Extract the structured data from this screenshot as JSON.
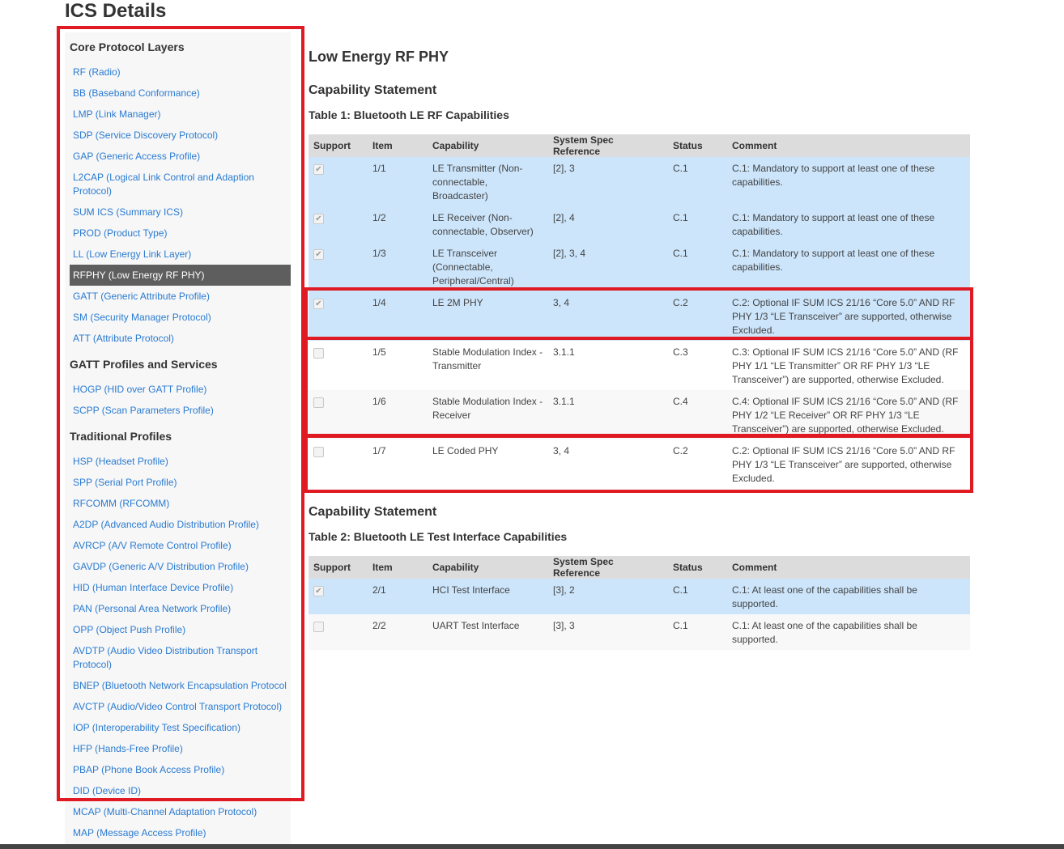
{
  "page": {
    "title": "ICS Details"
  },
  "sidebar": {
    "sections": [
      {
        "heading": "Core Protocol Layers",
        "items": [
          {
            "label": "RF (Radio)"
          },
          {
            "label": "BB (Baseband Conformance)"
          },
          {
            "label": "LMP (Link Manager)"
          },
          {
            "label": "SDP (Service Discovery Protocol)"
          },
          {
            "label": "GAP (Generic Access Profile)"
          },
          {
            "label": "L2CAP (Logical Link Control and Adaption Protocol)"
          },
          {
            "label": "SUM ICS (Summary ICS)"
          },
          {
            "label": "PROD (Product Type)"
          },
          {
            "label": "LL (Low Energy Link Layer)"
          },
          {
            "label": "RFPHY (Low Energy RF PHY)"
          },
          {
            "label": "GATT (Generic Attribute Profile)"
          },
          {
            "label": "SM (Security Manager Protocol)"
          },
          {
            "label": "ATT (Attribute Protocol)"
          }
        ]
      },
      {
        "heading": "GATT Profiles and Services",
        "items": [
          {
            "label": "HOGP (HID over GATT Profile)"
          },
          {
            "label": "SCPP (Scan Parameters Profile)"
          }
        ]
      },
      {
        "heading": "Traditional Profiles",
        "items": [
          {
            "label": "HSP (Headset Profile)"
          },
          {
            "label": "SPP (Serial Port Profile)"
          },
          {
            "label": "RFCOMM (RFCOMM)"
          },
          {
            "label": "A2DP (Advanced Audio Distribution Profile)"
          },
          {
            "label": "AVRCP (A/V Remote Control Profile)"
          },
          {
            "label": "GAVDP (Generic A/V Distribution Profile)"
          },
          {
            "label": "HID (Human Interface Device Profile)"
          },
          {
            "label": "PAN (Personal Area Network Profile)"
          },
          {
            "label": "OPP (Object Push Profile)"
          },
          {
            "label": "AVDTP (Audio Video Distribution Transport Protocol)"
          },
          {
            "label": "BNEP (Bluetooth Network Encapsulation Protocol"
          },
          {
            "label": "AVCTP (Audio/Video Control Transport Protocol)"
          },
          {
            "label": "IOP (Interoperability Test Specification)"
          },
          {
            "label": "HFP (Hands-Free Profile)"
          },
          {
            "label": "PBAP (Phone Book Access Profile)"
          },
          {
            "label": "DID (Device ID)"
          },
          {
            "label": "MCAP (Multi-Channel Adaptation Protocol)"
          },
          {
            "label": "MAP (Message Access Profile)"
          }
        ]
      }
    ],
    "active_item": "RFPHY (Low Energy RF PHY)"
  },
  "main": {
    "section_title": "Low Energy RF PHY",
    "headers": [
      "Support",
      "Item",
      "Capability",
      "System Spec Reference",
      "Status",
      "Comment"
    ],
    "tables": [
      {
        "capability_title": "Capability Statement",
        "table_title": "Table 1: Bluetooth LE RF Capabilities",
        "rows": [
          {
            "checked": true,
            "item": "1/1",
            "capability": "LE Transmitter (Non-connectable, Broadcaster)",
            "ref": "[2], 3",
            "status": "C.1",
            "comment": "C.1: Mandatory to support at least one of these capabilities."
          },
          {
            "checked": true,
            "item": "1/2",
            "capability": "LE Receiver (Non-connectable, Observer)",
            "ref": "[2], 4",
            "status": "C.1",
            "comment": "C.1: Mandatory to support at least one of these capabilities."
          },
          {
            "checked": true,
            "item": "1/3",
            "capability": "LE Transceiver (Connectable, Peripheral/Central)",
            "ref": "[2], 3, 4",
            "status": "C.1",
            "comment": "C.1: Mandatory to support at least one of these capabilities."
          },
          {
            "checked": true,
            "item": "1/4",
            "capability": "LE 2M PHY",
            "ref": "3, 4",
            "status": "C.2",
            "comment": "C.2: Optional IF SUM ICS 21/16 “Core 5.0” AND RF PHY 1/3 “LE Transceiver” are supported, otherwise Excluded."
          },
          {
            "checked": false,
            "item": "1/5",
            "capability": "Stable Modulation Index - Transmitter",
            "ref": "3.1.1",
            "status": "C.3",
            "comment": "C.3: Optional IF SUM ICS 21/16 “Core 5.0” AND (RF PHY 1/1 “LE Transmitter” OR RF PHY 1/3 “LE Transceiver”) are supported, otherwise Excluded."
          },
          {
            "checked": false,
            "item": "1/6",
            "capability": "Stable Modulation Index - Receiver",
            "ref": "3.1.1",
            "status": "C.4",
            "comment": "C.4: Optional IF SUM ICS 21/16 “Core 5.0” AND (RF PHY 1/2 “LE Receiver” OR RF PHY 1/3 “LE Transceiver”) are supported, otherwise Excluded."
          },
          {
            "checked": false,
            "item": "1/7",
            "capability": "LE Coded PHY",
            "ref": "3, 4",
            "status": "C.2",
            "comment": "C.2: Optional IF SUM ICS 21/16 “Core 5.0” AND RF PHY 1/3 “LE Transceiver” are supported, otherwise Excluded."
          }
        ]
      },
      {
        "capability_title": "Capability Statement",
        "table_title": "Table 2: Bluetooth LE Test Interface Capabilities",
        "rows": [
          {
            "checked": true,
            "item": "2/1",
            "capability": "HCI Test Interface",
            "ref": "[3], 2",
            "status": "C.1",
            "comment": "C.1: At least one of the capabilities shall be supported."
          },
          {
            "checked": false,
            "item": "2/2",
            "capability": "UART Test Interface",
            "ref": "[3], 3",
            "status": "C.1",
            "comment": "C.1: At least one of the capabilities shall be supported."
          }
        ]
      }
    ]
  },
  "colors": {
    "link": "#2a7bd1",
    "active_bg": "#5e5e5e",
    "selected_row": "#cce5fb",
    "header_bg": "#dcdcdc",
    "highlight_border": "#e01a22"
  }
}
